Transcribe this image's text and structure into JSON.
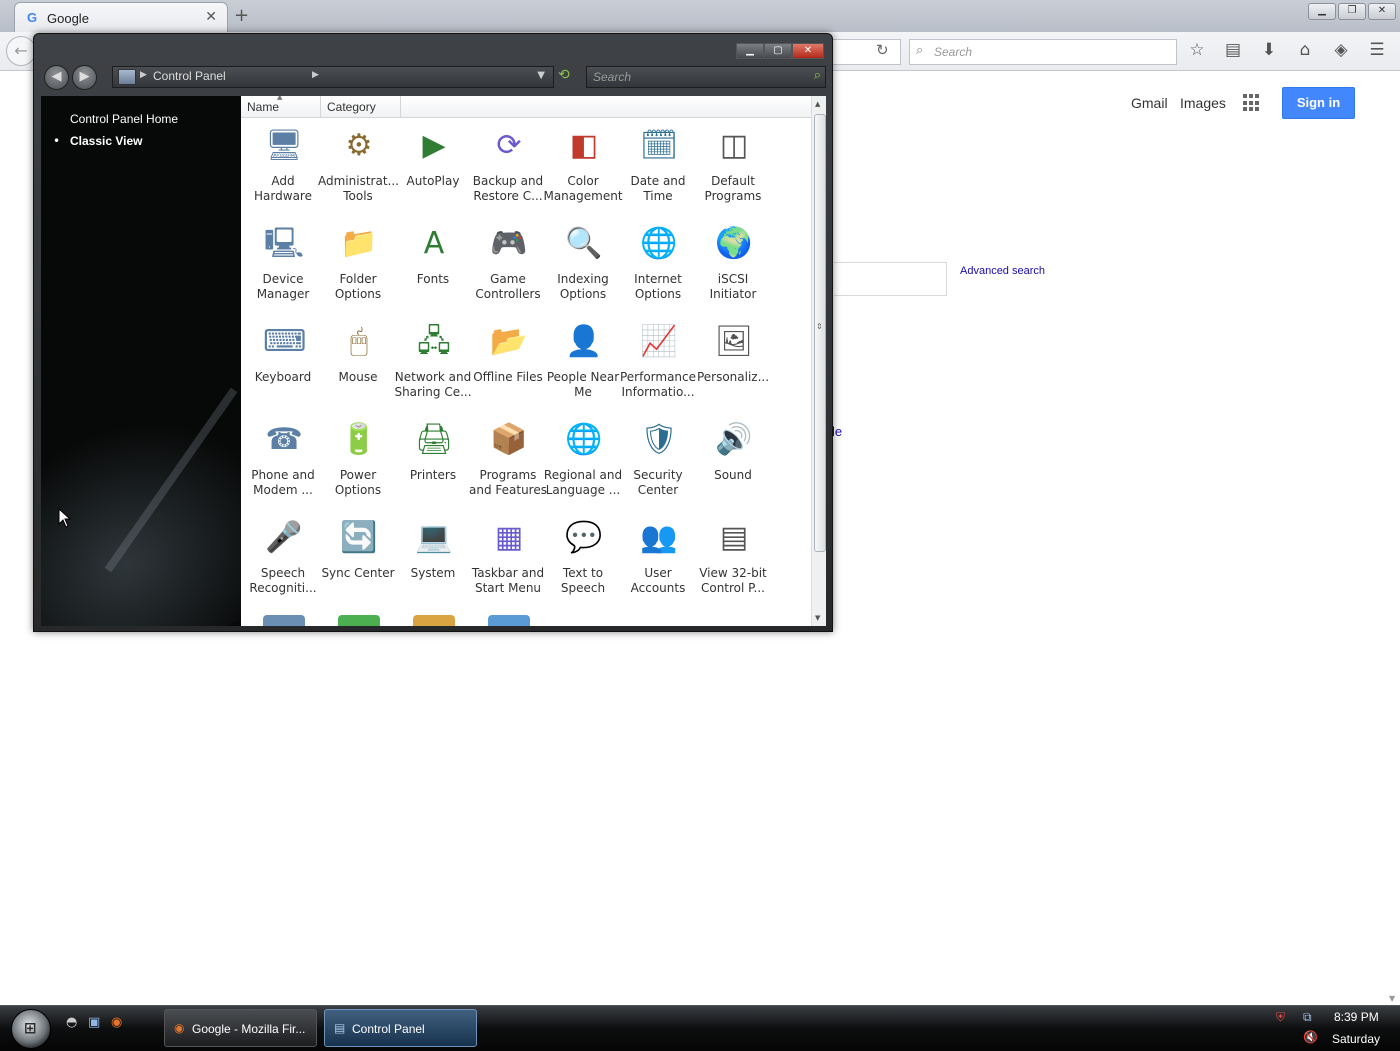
{
  "browser": {
    "tab_title": "Google",
    "tab_favicon": "G",
    "tab_close": "✕",
    "new_tab": "+",
    "back": "←",
    "reload": "↻",
    "search_placeholder": "Search",
    "window_buttons": [
      "▁",
      "❐",
      "✕"
    ],
    "toolbar_icons": [
      "star-icon",
      "reading-list-icon",
      "download-icon",
      "home-icon",
      "pocket-icon",
      "menu-icon"
    ]
  },
  "google": {
    "gmail": "Gmail",
    "images": "Images",
    "sign_in": "Sign in",
    "advanced_search": "Advanced search",
    "partial_link": "le",
    "accent_color": "#4387fd"
  },
  "control_panel": {
    "breadcrumb": "Control Panel",
    "search_placeholder": "Search",
    "left_nav": {
      "home": "Control Panel Home",
      "classic": "Classic View"
    },
    "columns": [
      "Name",
      "Category"
    ],
    "items": [
      {
        "label": "Add Hardware",
        "icon": "hardware-icon"
      },
      {
        "label": "Administrat... Tools",
        "icon": "admin-tools-icon"
      },
      {
        "label": "AutoPlay",
        "icon": "autoplay-icon"
      },
      {
        "label": "Backup and Restore C...",
        "icon": "backup-icon"
      },
      {
        "label": "Color Management",
        "icon": "color-icon"
      },
      {
        "label": "Date and Time",
        "icon": "calendar-clock-icon"
      },
      {
        "label": "Default Programs",
        "icon": "default-programs-icon"
      },
      {
        "label": "Device Manager",
        "icon": "device-manager-icon"
      },
      {
        "label": "Folder Options",
        "icon": "folder-options-icon"
      },
      {
        "label": "Fonts",
        "icon": "fonts-icon"
      },
      {
        "label": "Game Controllers",
        "icon": "gamepad-icon"
      },
      {
        "label": "Indexing Options",
        "icon": "indexing-icon"
      },
      {
        "label": "Internet Options",
        "icon": "internet-options-icon"
      },
      {
        "label": "iSCSI Initiator",
        "icon": "iscsi-icon"
      },
      {
        "label": "Keyboard",
        "icon": "keyboard-icon"
      },
      {
        "label": "Mouse",
        "icon": "mouse-icon"
      },
      {
        "label": "Network and Sharing Ce...",
        "icon": "network-icon"
      },
      {
        "label": "Offline Files",
        "icon": "offline-files-icon"
      },
      {
        "label": "People Near Me",
        "icon": "people-near-me-icon"
      },
      {
        "label": "Performance Informatio...",
        "icon": "performance-icon"
      },
      {
        "label": "Personaliz...",
        "icon": "personalization-icon"
      },
      {
        "label": "Phone and Modem ...",
        "icon": "phone-icon"
      },
      {
        "label": "Power Options",
        "icon": "power-icon"
      },
      {
        "label": "Printers",
        "icon": "printer-icon"
      },
      {
        "label": "Programs and Features",
        "icon": "programs-icon"
      },
      {
        "label": "Regional and Language ...",
        "icon": "globe-clock-icon"
      },
      {
        "label": "Security Center",
        "icon": "shield-icon"
      },
      {
        "label": "Sound",
        "icon": "speaker-icon"
      },
      {
        "label": "Speech Recogniti...",
        "icon": "microphone-icon"
      },
      {
        "label": "Sync Center",
        "icon": "sync-icon"
      },
      {
        "label": "System",
        "icon": "system-icon"
      },
      {
        "label": "Taskbar and Start Menu",
        "icon": "taskbar-icon"
      },
      {
        "label": "Text to Speech",
        "icon": "text-to-speech-icon"
      },
      {
        "label": "User Accounts",
        "icon": "users-icon"
      },
      {
        "label": "View 32-bit Control P...",
        "icon": "control-panel-32-icon"
      }
    ]
  },
  "taskbar": {
    "buttons": [
      "Google - Mozilla Fir...",
      "Control Panel"
    ],
    "time": "8:39 PM",
    "day": "Saturday"
  }
}
